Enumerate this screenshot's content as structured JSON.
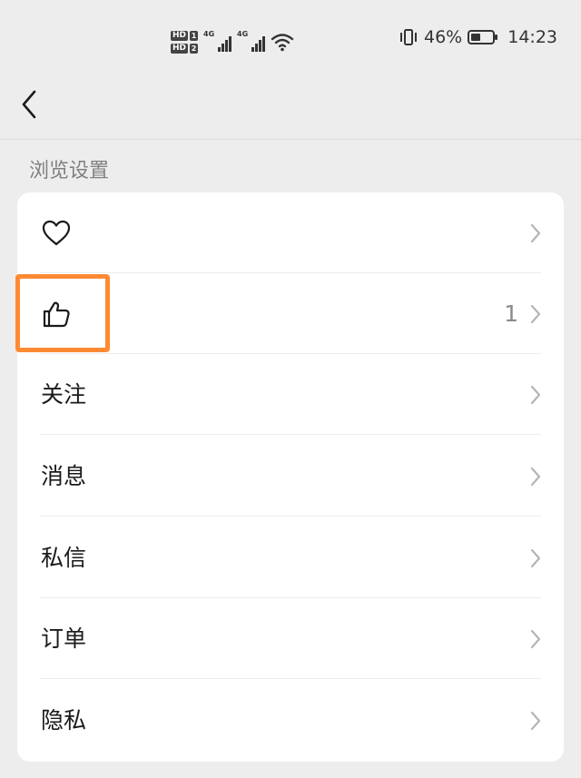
{
  "status_bar": {
    "hd1": "HD",
    "sim1": "1",
    "hd2": "HD",
    "sim2": "2",
    "net1": "4G",
    "net2": "4G",
    "battery_text": "46%",
    "battery_level": 0.46,
    "time": "14:23"
  },
  "header": {
    "back_icon": "chevron-left-icon"
  },
  "section": {
    "title": "浏览设置"
  },
  "rows": [
    {
      "icon": "heart-icon",
      "label": "",
      "count": ""
    },
    {
      "icon": "thumbs-up-icon",
      "label": "",
      "count": "1"
    },
    {
      "icon": "",
      "label": "关注",
      "count": ""
    },
    {
      "icon": "",
      "label": "消息",
      "count": ""
    },
    {
      "icon": "",
      "label": "私信",
      "count": ""
    },
    {
      "icon": "",
      "label": "订单",
      "count": ""
    },
    {
      "icon": "",
      "label": "隐私",
      "count": ""
    }
  ],
  "colors": {
    "background": "#ededed",
    "card": "#ffffff",
    "highlight": "#ff8a33",
    "muted_text": "#808080"
  }
}
